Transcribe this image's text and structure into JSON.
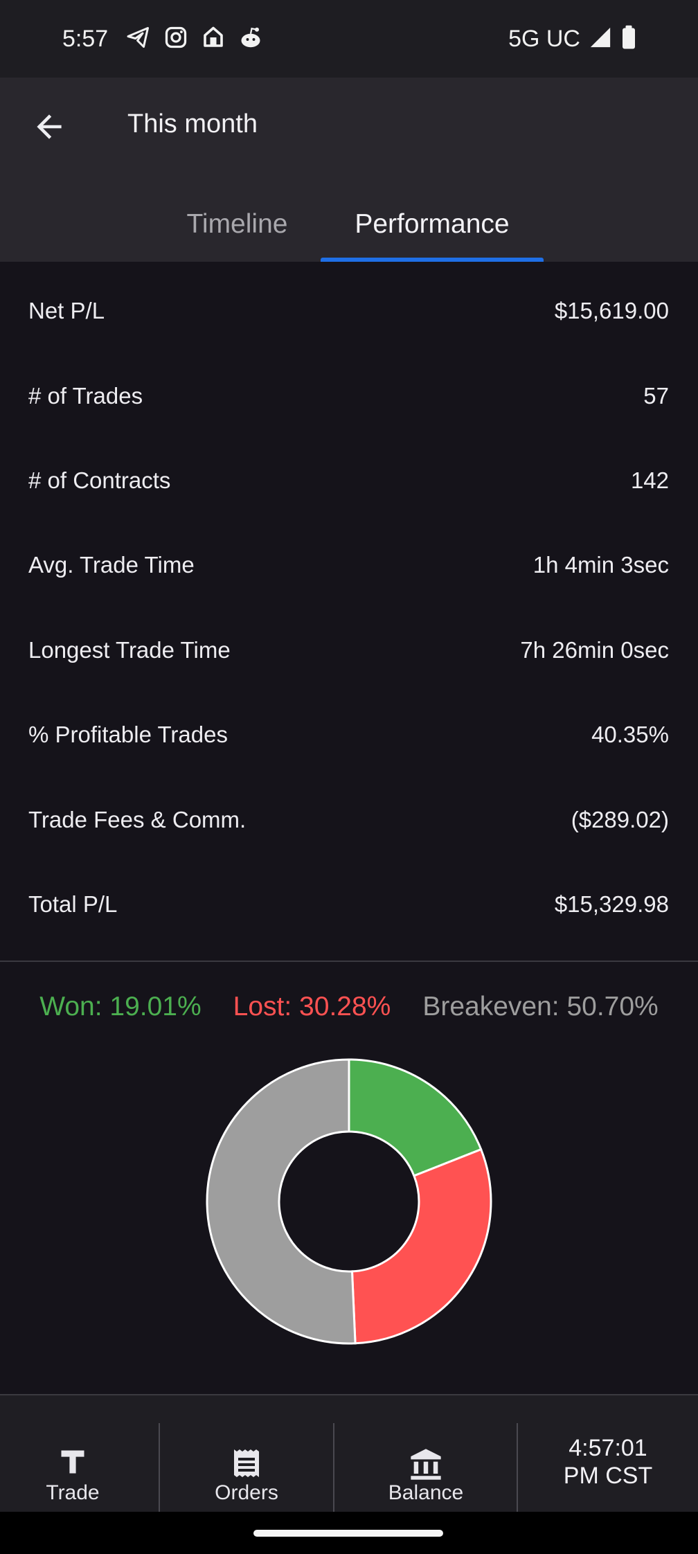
{
  "status_bar": {
    "time": "5:57",
    "network": "5G UC",
    "icons": [
      "telegram-icon",
      "instagram-icon",
      "home-icon",
      "reddit-icon",
      "signal-icon",
      "battery-icon"
    ]
  },
  "header": {
    "title": "This month",
    "tabs": [
      {
        "label": "Timeline",
        "active": false
      },
      {
        "label": "Performance",
        "active": true
      }
    ]
  },
  "stats": [
    {
      "label": "Net P/L",
      "value": "$15,619.00"
    },
    {
      "label": "# of Trades",
      "value": "57"
    },
    {
      "label": "# of Contracts",
      "value": "142"
    },
    {
      "label": "Avg. Trade Time",
      "value": "1h 4min 3sec"
    },
    {
      "label": "Longest Trade Time",
      "value": "7h 26min 0sec"
    },
    {
      "label": "% Profitable Trades",
      "value": "40.35%"
    },
    {
      "label": "Trade Fees & Comm.",
      "value": "($289.02)"
    },
    {
      "label": "Total P/L",
      "value": "$15,329.98"
    }
  ],
  "legend": {
    "won": "Won: 19.01%",
    "lost": "Lost: 30.28%",
    "breakeven": "Breakeven: 50.70%"
  },
  "chart_data": {
    "type": "pie",
    "donut": true,
    "categories": [
      "Won",
      "Lost",
      "Breakeven"
    ],
    "values": [
      19.01,
      30.28,
      50.7
    ],
    "colors": [
      "#4caf50",
      "#ff5252",
      "#9e9e9e"
    ]
  },
  "bottom_nav": {
    "items": [
      {
        "label": "Trade",
        "icon": "trade-icon"
      },
      {
        "label": "Orders",
        "icon": "orders-icon"
      },
      {
        "label": "Balance",
        "icon": "balance-icon"
      }
    ],
    "clock_line1": "4:57:01",
    "clock_line2": "PM CST"
  },
  "colors": {
    "accent": "#1f6fe6",
    "won": "#4caf50",
    "lost": "#ff5252",
    "breakeven": "#9e9e9e",
    "background": "#15131a"
  }
}
